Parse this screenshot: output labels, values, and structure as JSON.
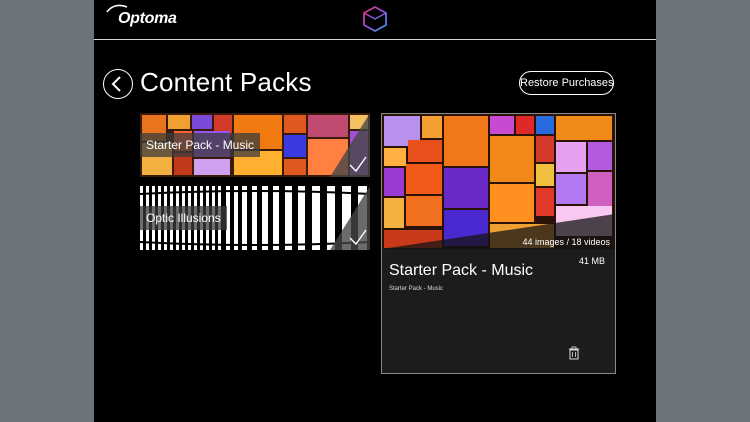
{
  "header": {
    "brand": "Optoma",
    "center_icon": "cube-logo-icon"
  },
  "page": {
    "title": "Content Packs",
    "back_icon": "chevron-left-icon",
    "restore_label": "Restore Purchases"
  },
  "packs": [
    {
      "label": "Starter Pack - Music",
      "installed": true
    },
    {
      "label": "Optic Illusions",
      "installed": true
    }
  ],
  "detail": {
    "title": "Starter Pack - Music",
    "subtitle": "Starter Pack - Music",
    "media_count": "44 images / 18 videos",
    "size": "41 MB",
    "delete_icon": "trash-icon"
  },
  "colors": {
    "app_background": "#000000",
    "frame_background": "#6b737b",
    "panel_background": "#1c1c1c"
  }
}
